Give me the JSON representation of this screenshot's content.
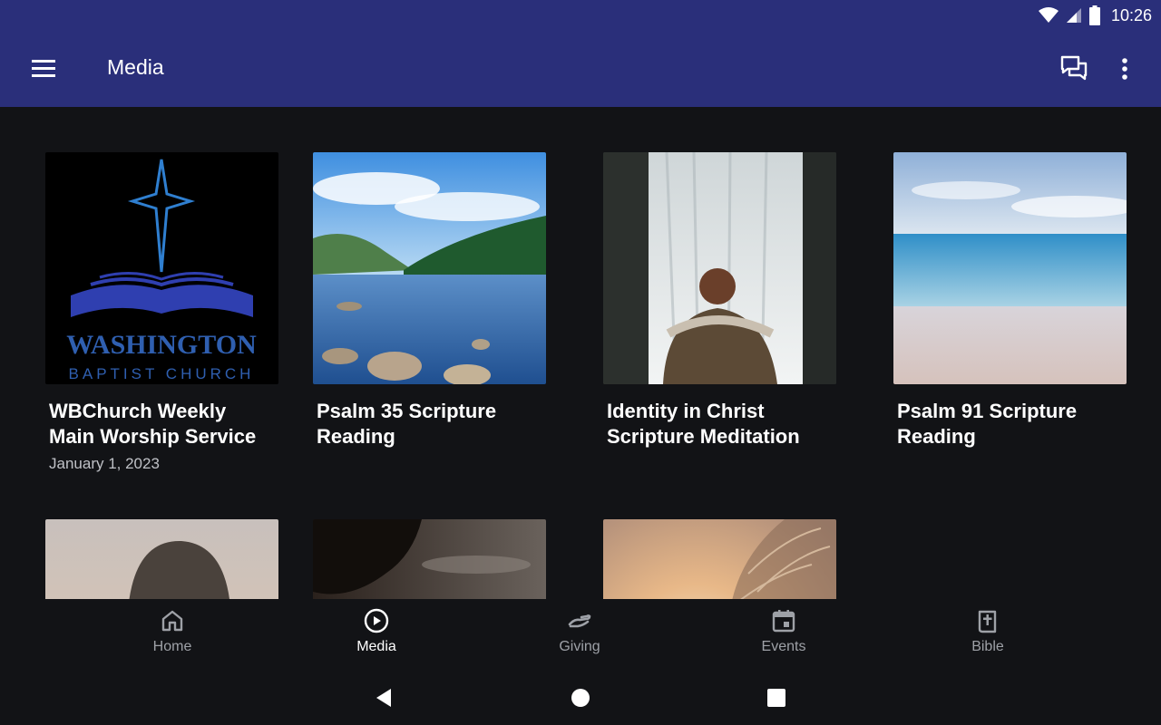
{
  "status": {
    "time": "10:26"
  },
  "appbar": {
    "title": "Media"
  },
  "media_items": [
    {
      "title": "WBChurch Weekly Main Worship Service",
      "date": "January 1, 2023",
      "logo_line1": "WASHINGTON",
      "logo_line2": "BAPTIST CHURCH"
    },
    {
      "title": "Psalm 35 Scripture Reading"
    },
    {
      "title": "Identity in Christ Scripture Meditation"
    },
    {
      "title": "Psalm 91 Scripture Reading"
    },
    {
      "title": ""
    },
    {
      "title": ""
    },
    {
      "title": ""
    }
  ],
  "bottom_nav": [
    {
      "label": "Home",
      "icon": "home-icon"
    },
    {
      "label": "Media",
      "icon": "play-circle-icon",
      "active": true
    },
    {
      "label": "Giving",
      "icon": "giving-hand-icon"
    },
    {
      "label": "Events",
      "icon": "calendar-icon"
    },
    {
      "label": "Bible",
      "icon": "bible-icon"
    }
  ],
  "colors": {
    "appbar": "#2a2f7a",
    "background": "#121316",
    "logo_blue": "#2f5fb0",
    "nav_inactive": "#9ea1a7"
  }
}
